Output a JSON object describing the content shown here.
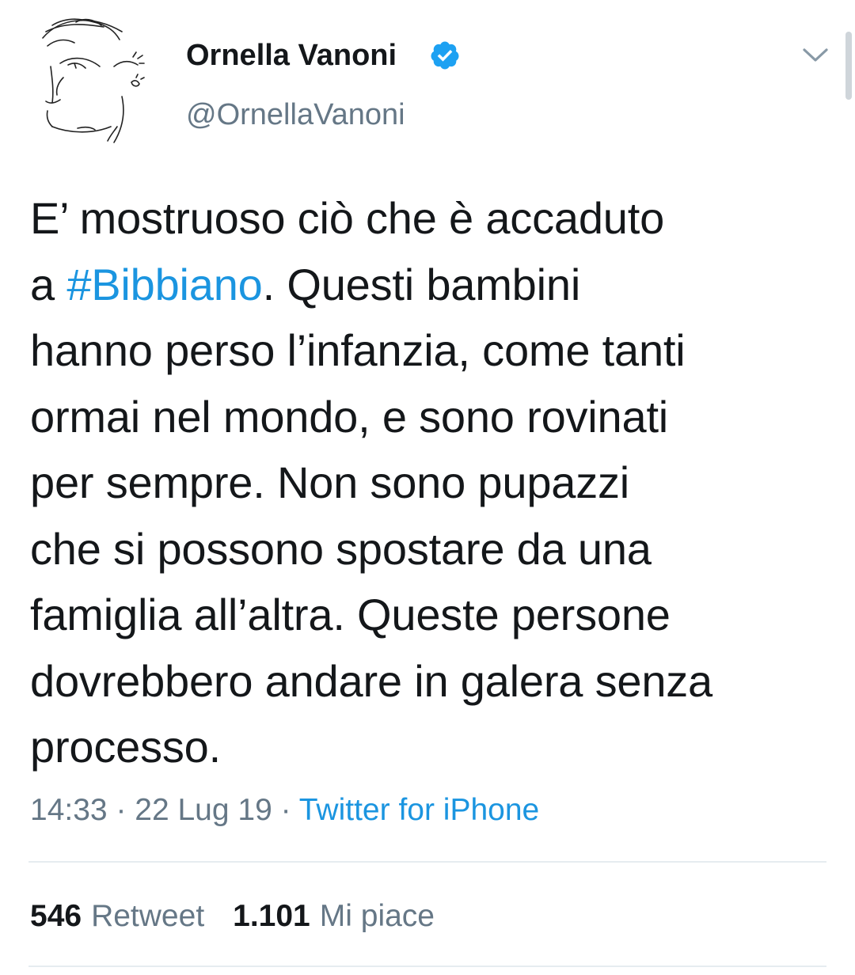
{
  "user": {
    "display_name": "Ornella Vanoni",
    "handle": "@OrnellaVanoni",
    "verified": true,
    "avatar_icon": "sketched-face-avatar"
  },
  "tweet": {
    "lines": [
      [
        {
          "text": "E’ mostruoso ciò che è accaduto"
        }
      ],
      [
        {
          "text": "a "
        },
        {
          "text": "#Bibbiano",
          "hashtag": true
        },
        {
          "text": ". Questi bambini"
        }
      ],
      [
        {
          "text": "hanno perso l’infanzia, come tanti"
        }
      ],
      [
        {
          "text": "ormai nel mondo, e sono rovinati"
        }
      ],
      [
        {
          "text": "per sempre. Non sono pupazzi"
        }
      ],
      [
        {
          "text": "che si possono spostare da una"
        }
      ],
      [
        {
          "text": "famiglia all’altra. Queste persone"
        }
      ],
      [
        {
          "text": "dovrebbero andare in galera senza"
        }
      ],
      [
        {
          "text": "processo."
        }
      ]
    ]
  },
  "meta": {
    "time": "14:33",
    "separator": " · ",
    "date": "22 Lug 19",
    "source": "Twitter for iPhone"
  },
  "stats": {
    "retweets_value": "546",
    "retweets_label": "Retweet",
    "likes_value": "1.101",
    "likes_label": "Mi piace"
  },
  "colors": {
    "link": "#1b95e0",
    "secondary_text": "#657786",
    "primary_text": "#14171a",
    "verified_badge": "#1da1f2",
    "divider": "#e6ecf0"
  },
  "icons": {
    "verified": "verified-badge-icon",
    "menu": "chevron-down-icon"
  }
}
